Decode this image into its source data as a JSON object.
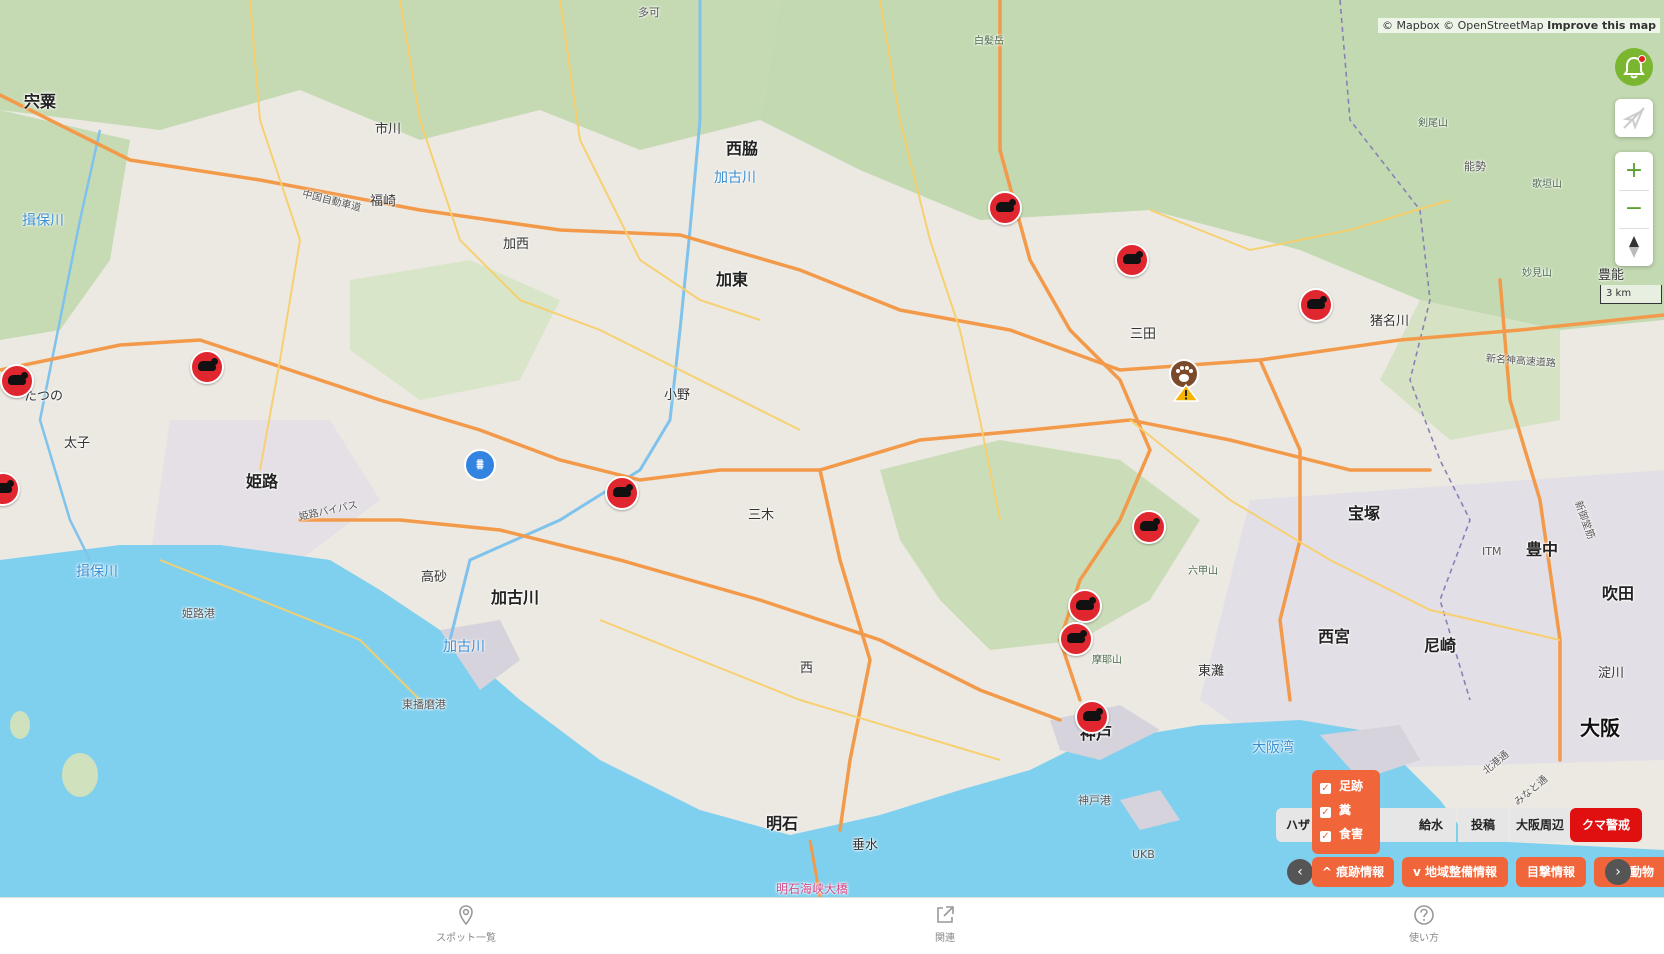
{
  "attribution": {
    "mapbox": "© Mapbox",
    "osm": "© OpenStreetMap",
    "improve": "Improve this map"
  },
  "scale_label": "3 km",
  "places": {
    "shiso": "宍粟",
    "ichikawa": "市川",
    "fukusaki": "福崎",
    "kasai": "加西",
    "nishiwaki": "西脇",
    "kato": "加東",
    "ono": "小野",
    "miki": "三木",
    "tatsuno": "たつの",
    "taishi": "太子",
    "himeji": "姫路",
    "takasago": "高砂",
    "kakogawa_city": "加古川",
    "nishi": "西",
    "akashi": "明石",
    "tarumi": "垂水",
    "kobe": "神戸",
    "sanda": "三田",
    "takarazuka": "宝塚",
    "nishinomiya": "西宮",
    "amagasaki": "尼崎",
    "osaka": "大阪",
    "toyonaka": "豊中",
    "suita": "吹田",
    "yodogawa": "淀川",
    "inagawa": "猪名川",
    "toyono": "豊能",
    "nose": "能勢",
    "taka": "多可",
    "higashinada": "東灘"
  },
  "water_labels": {
    "ibo_river_n": "揖保川",
    "ibo_river_s": "揖保川",
    "kako_river_n": "加古川",
    "kako_river_s": "加古川",
    "osaka_bay": "大阪湾"
  },
  "small_labels": {
    "himeji_port": "姫路港",
    "higashiharima_port": "東播磨港",
    "kobe_port": "神戸港",
    "ukb": "UKB",
    "itm": "ITM",
    "shiragamine": "白髪岳",
    "kenbisan": "剣尾山",
    "utagaki": "歌垣山",
    "myokensan": "妙見山",
    "rokko": "六甲山",
    "maya": "摩耶山",
    "akashi_bridge": "明石海峡大橋"
  },
  "road_labels": {
    "chugoku_exp": "中国自動車道",
    "himeji_bypass": "姫路バイパス",
    "shinmeishin": "新名神高速道路",
    "hokkodo": "北港通",
    "minatomachi": "みなと通",
    "shin_midosuji": "新御堂筋"
  },
  "tabs": [
    {
      "label": "ハザ"
    },
    {
      "label": "給水"
    },
    {
      "label": "投稿"
    },
    {
      "label": "大阪周辺"
    },
    {
      "label": "クマ警戒"
    }
  ],
  "filters": [
    {
      "label": "痕跡情報",
      "chevron": "^"
    },
    {
      "label": "地域整備情報",
      "chevron": "v"
    },
    {
      "label": "目撃情報",
      "chevron": ""
    },
    {
      "label": "動物",
      "chevron": ""
    }
  ],
  "checks": [
    {
      "label": "足跡",
      "checked": true
    },
    {
      "label": "糞",
      "checked": true
    },
    {
      "label": "食害",
      "checked": true
    }
  ],
  "bottom_nav": [
    {
      "label": "スポット一覧",
      "icon": "map-pin-icon"
    },
    {
      "label": "関連",
      "icon": "external-link-icon"
    },
    {
      "label": "使い方",
      "icon": "help-icon"
    }
  ],
  "colors": {
    "bear_marker": "#e0262f",
    "warn_tab": "#e01010",
    "filter_chip": "#f0653a",
    "control_green": "#5aa02c",
    "sea": "#7fd0ef"
  }
}
